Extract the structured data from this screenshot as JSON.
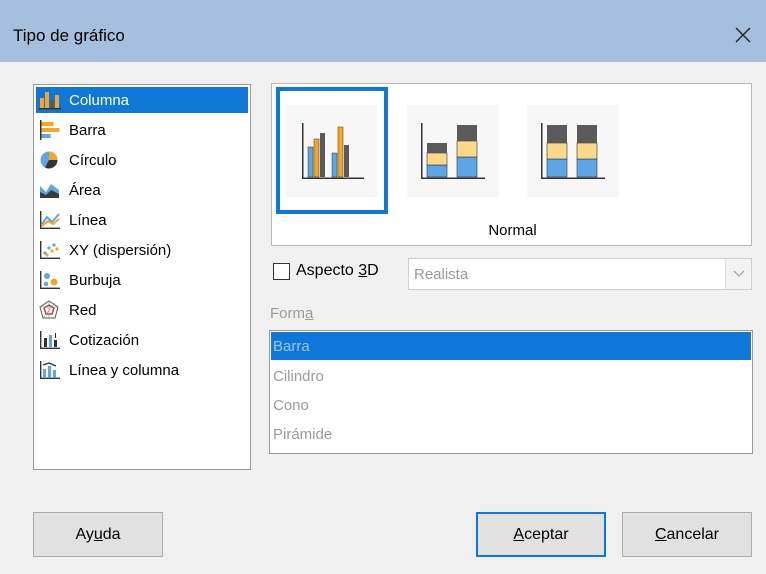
{
  "dialog": {
    "title": "Tipo de gráfico"
  },
  "chart_types": [
    {
      "label": "Columna",
      "icon": "column-chart-icon",
      "selected": true
    },
    {
      "label": "Barra",
      "icon": "bar-chart-icon"
    },
    {
      "label": "Círculo",
      "icon": "pie-chart-icon"
    },
    {
      "label": "Área",
      "icon": "area-chart-icon"
    },
    {
      "label": "Línea",
      "icon": "line-chart-icon"
    },
    {
      "label": "XY (dispersión)",
      "icon": "scatter-chart-icon"
    },
    {
      "label": "Burbuja",
      "icon": "bubble-chart-icon"
    },
    {
      "label": "Red",
      "icon": "net-chart-icon"
    },
    {
      "label": "Cotización",
      "icon": "stock-chart-icon"
    },
    {
      "label": "Línea y columna",
      "icon": "column-line-chart-icon"
    }
  ],
  "variants": {
    "selected_caption": "Normal",
    "items": [
      "normal",
      "stacked",
      "percent-stacked"
    ]
  },
  "aspect3d": {
    "label_pre": "Aspecto ",
    "label_key": "3",
    "label_post": "D",
    "checked": false
  },
  "appearance": {
    "value": "Realista"
  },
  "shape": {
    "label_pre": "Form",
    "label_key": "a",
    "options": [
      "Barra",
      "Cilindro",
      "Cono",
      "Pirámide"
    ],
    "selected": "Barra"
  },
  "buttons": {
    "help": {
      "pre": "Ay",
      "key": "u",
      "post": "da"
    },
    "ok": {
      "pre": "",
      "key": "A",
      "post": "ceptar"
    },
    "cancel": {
      "pre": "",
      "key": "C",
      "post": "ancelar"
    }
  },
  "colors": {
    "titlebar": "#a6bfdc",
    "selection": "#0e77d7",
    "series_orange": "#f6a623",
    "series_blue": "#5aa6e6",
    "series_gray": "#5a5a5a",
    "series_yellow": "#fbd88a"
  }
}
